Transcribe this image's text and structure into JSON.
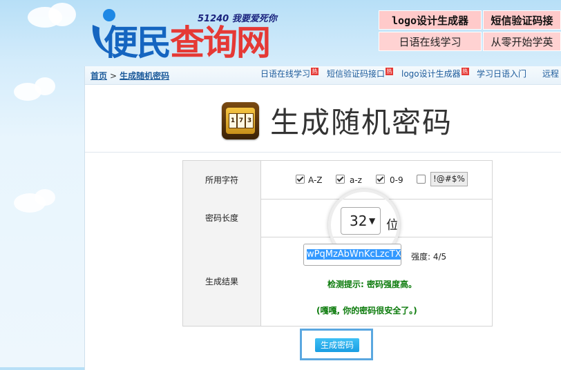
{
  "header": {
    "logo_main_a": "便民",
    "logo_main_b": "查询网",
    "logo_slogan": "51240 我要爱死你",
    "buttons": [
      {
        "label": "logo设计生成器"
      },
      {
        "label": "短信验证码接"
      },
      {
        "label": "日语在线学习"
      },
      {
        "label": "从零开始学英"
      }
    ]
  },
  "nav": {
    "breadcrumb_home": "首页",
    "breadcrumb_sep": ">",
    "breadcrumb_current": "生成随机密码",
    "links": [
      {
        "label": "日语在线学习",
        "hot": "热"
      },
      {
        "label": "短信验证码接口",
        "hot": "热"
      },
      {
        "label": "logo设计生成器",
        "hot": "热"
      },
      {
        "label": "学习日语入门",
        "hot": ""
      },
      {
        "label": "远程",
        "hot": ""
      }
    ]
  },
  "title": {
    "text": "生成随机密码",
    "icon_digits": [
      "1",
      "7",
      "3"
    ]
  },
  "form": {
    "chars_label": "所用字符",
    "options": [
      {
        "label": "A-Z",
        "checked": true
      },
      {
        "label": "a-z",
        "checked": true
      },
      {
        "label": "0-9",
        "checked": true
      },
      {
        "label": "!@#$%",
        "checked": false
      }
    ],
    "length_label": "密码长度",
    "length_value": "32",
    "length_arrow": "▼",
    "length_unit": "位",
    "result_label": "生成结果",
    "result_value": "wPqMzAbWnKcLzcTX",
    "strength": "强度: 4/5",
    "tip": "检测提示: 密码强度高。",
    "safe": "(嘎嘎, 你的密码很安全了。)"
  },
  "generate_button": "生成密码"
}
